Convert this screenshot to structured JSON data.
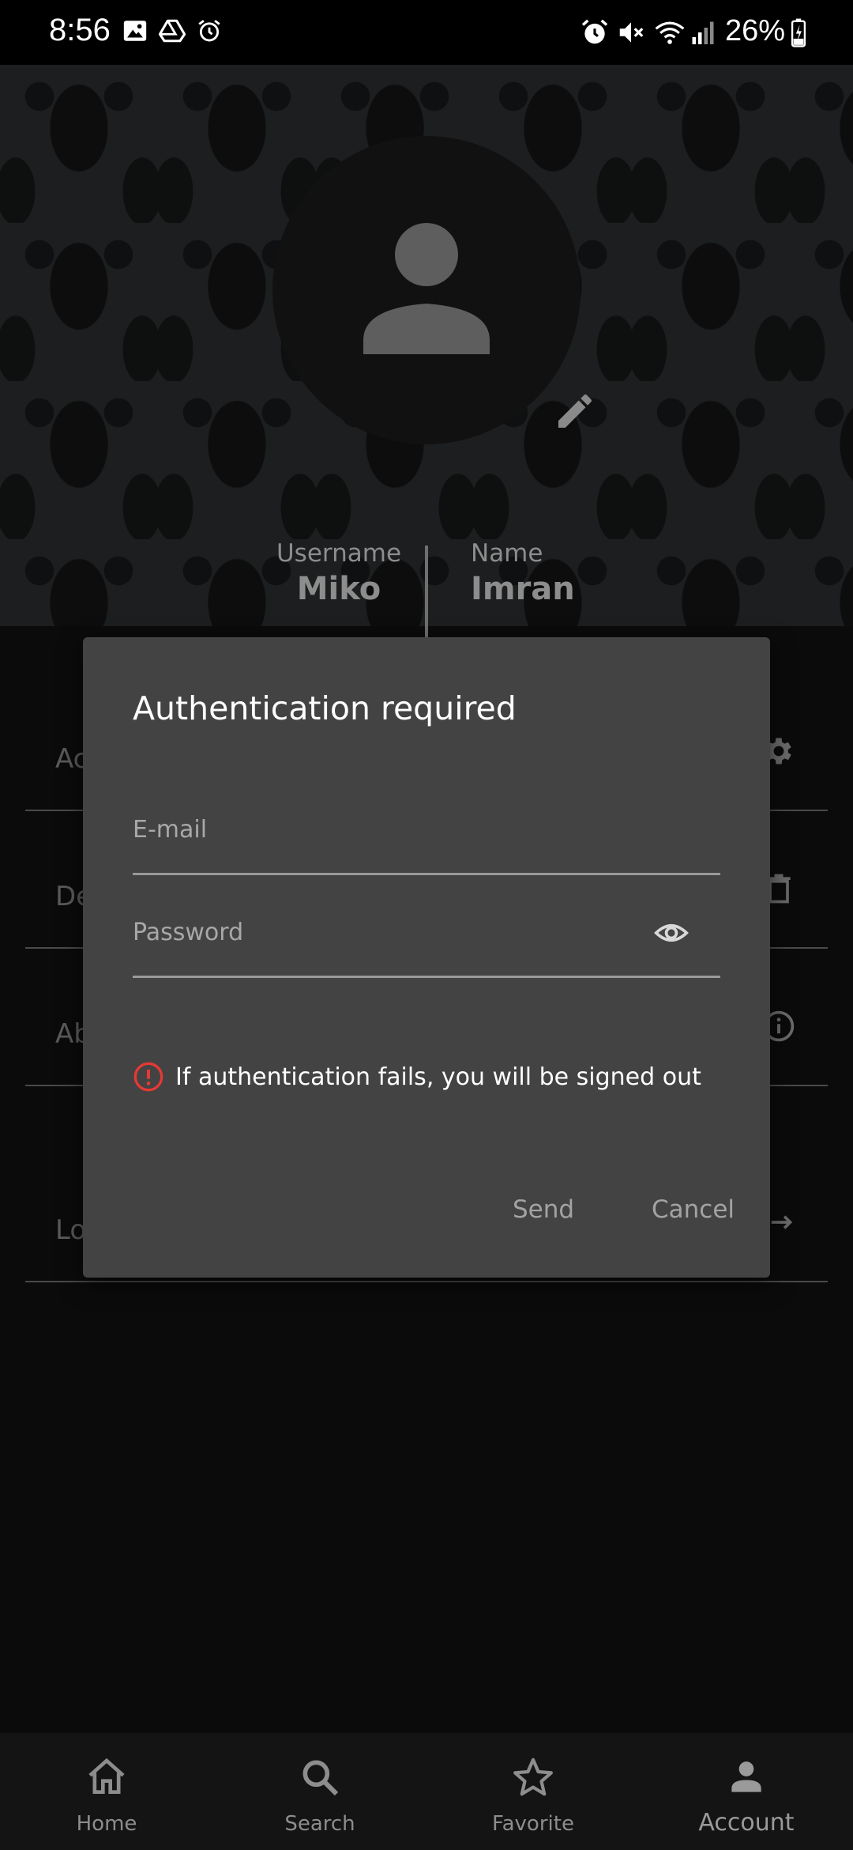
{
  "status_bar": {
    "time": "8:56",
    "battery": "26%",
    "left_icons": [
      "image-icon",
      "drive-icon",
      "alarm-icon"
    ],
    "right_icons": [
      "alarm-icon",
      "mute-icon",
      "wifi-icon",
      "signal-icon",
      "battery-icon"
    ]
  },
  "profile": {
    "username_label": "Username",
    "username": "Miko",
    "name_label": "Name",
    "name": "Imran"
  },
  "background_list": {
    "items": [
      {
        "label": "Ac",
        "icon": "gear-icon"
      },
      {
        "label": "De",
        "icon": "trash-icon"
      },
      {
        "label": "Ab",
        "icon": "info-icon"
      },
      {
        "label": "Lo",
        "icon": "logout-icon"
      }
    ]
  },
  "dialog": {
    "title": "Authentication required",
    "email_placeholder": "E-mail",
    "password_placeholder": "Password",
    "warning": "If authentication fails, you will be signed out",
    "send_label": "Send",
    "cancel_label": "Cancel",
    "warning_color": "#e53935"
  },
  "bottom_nav": {
    "items": [
      {
        "label": "Home",
        "icon": "home-icon"
      },
      {
        "label": "Search",
        "icon": "search-icon"
      },
      {
        "label": "Favorite",
        "icon": "star-icon"
      },
      {
        "label": "Account",
        "icon": "account-icon"
      }
    ],
    "active": "Account"
  }
}
